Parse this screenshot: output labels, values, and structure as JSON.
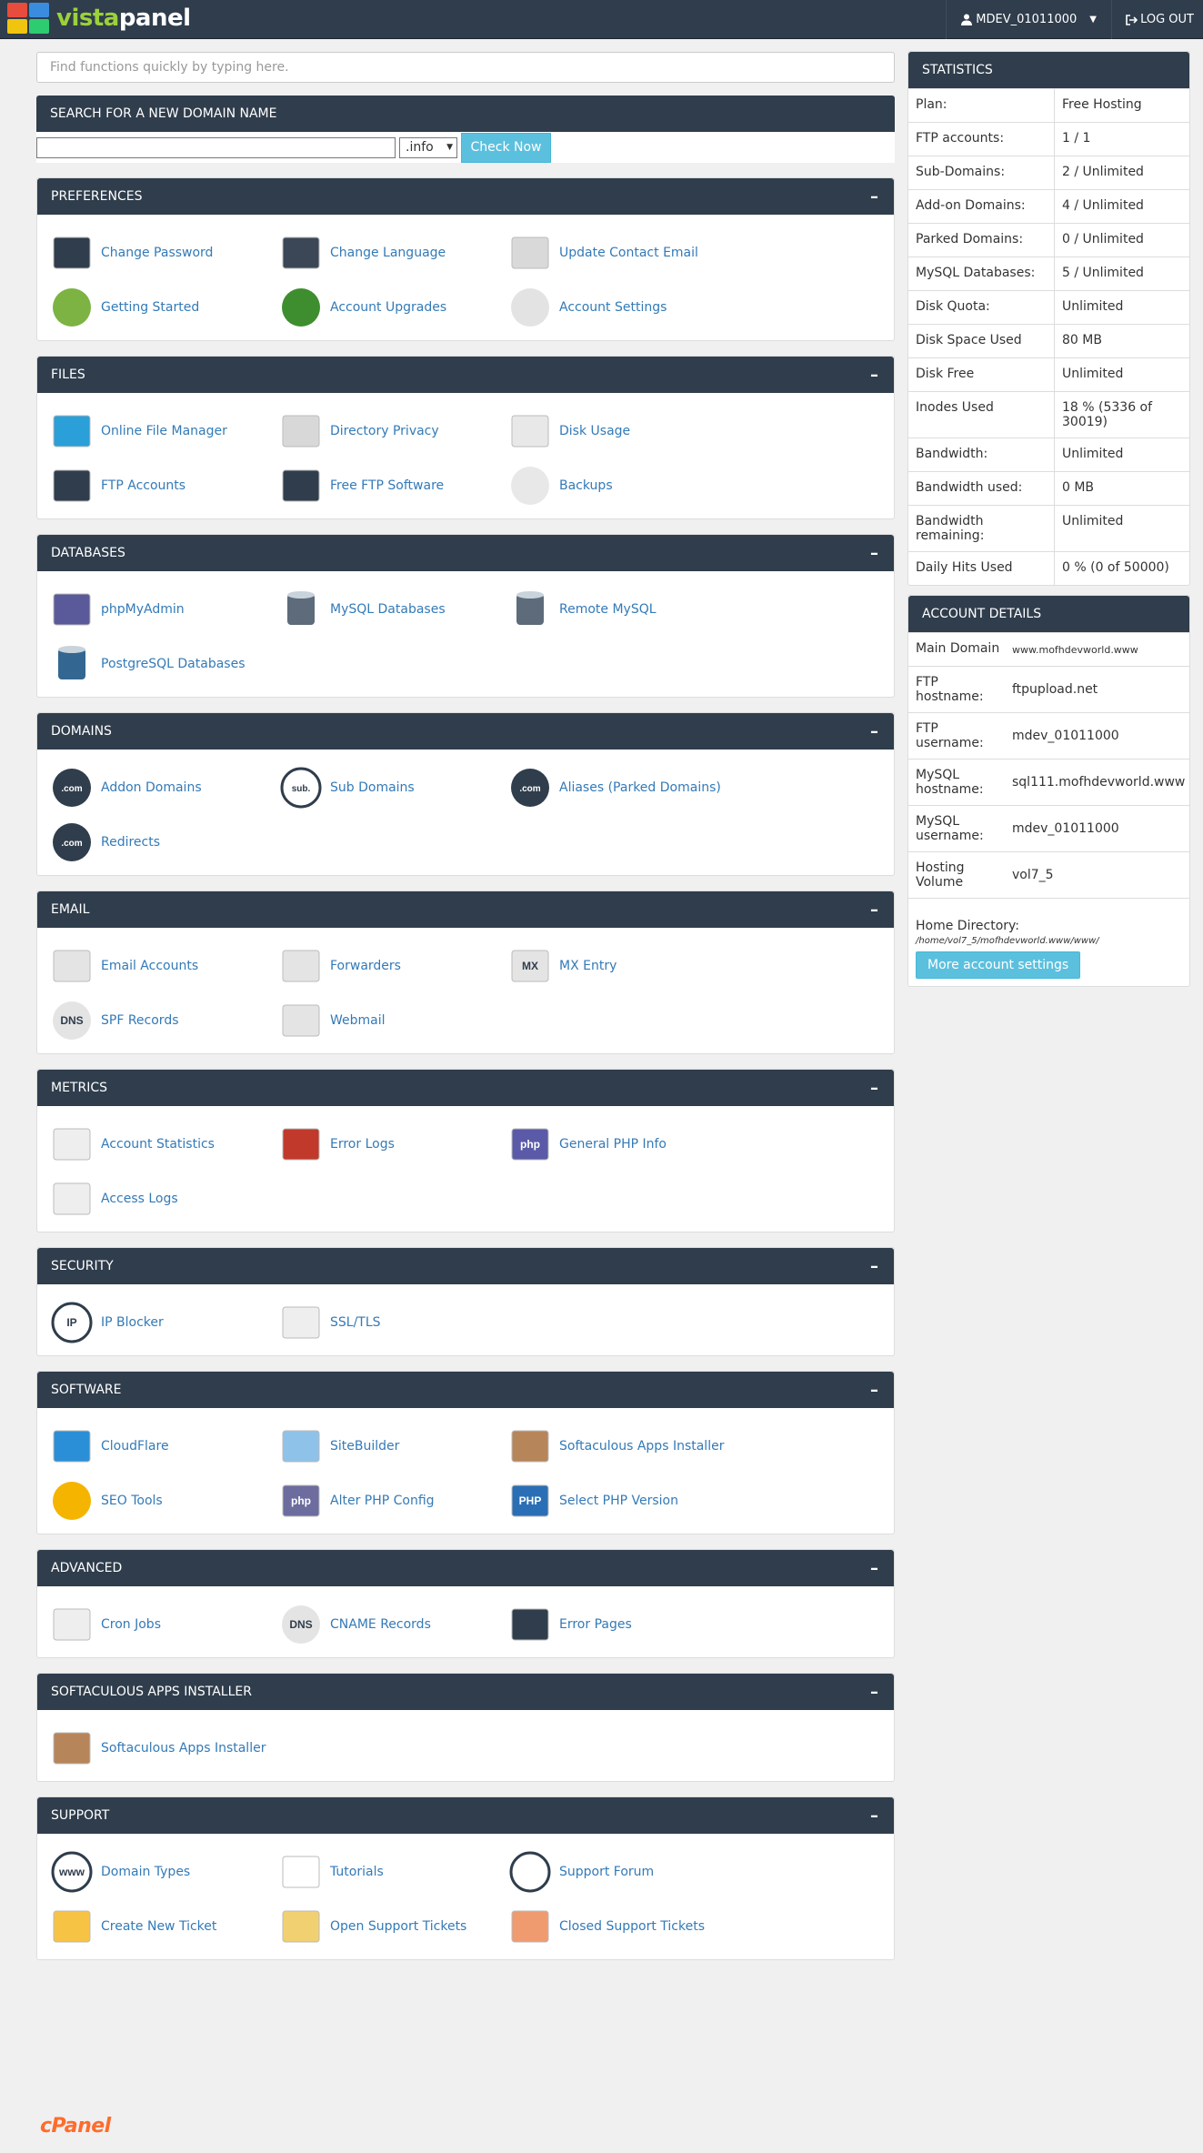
{
  "header": {
    "logo_vista": "vista",
    "logo_panel": "panel",
    "user": "MDEV_01011000",
    "logout": "LOG OUT",
    "colors": {
      "bar": "#2f3d4c",
      "logo_green": "#9bd13a"
    }
  },
  "quick_search": {
    "placeholder": "Find functions quickly by typing here."
  },
  "domain_search": {
    "title": "SEARCH FOR A NEW DOMAIN NAME",
    "tld": ".info",
    "button": "Check Now"
  },
  "sections": [
    {
      "title": "PREFERENCES",
      "items": [
        {
          "label": "Change Password",
          "icon": "password-icon"
        },
        {
          "label": "Change Language",
          "icon": "language-icon"
        },
        {
          "label": "Update Contact Email",
          "icon": "contact-card-icon"
        },
        {
          "label": "Getting Started",
          "icon": "getting-started-icon"
        },
        {
          "label": "Account Upgrades",
          "icon": "dragon-icon"
        },
        {
          "label": "Account Settings",
          "icon": "account-settings-icon"
        }
      ]
    },
    {
      "title": "FILES",
      "items": [
        {
          "label": "Online File Manager",
          "icon": "file-manager-icon"
        },
        {
          "label": "Directory Privacy",
          "icon": "folder-icon"
        },
        {
          "label": "Disk Usage",
          "icon": "disk-usage-icon"
        },
        {
          "label": "FTP Accounts",
          "icon": "ftp-truck-icon"
        },
        {
          "label": "Free FTP Software",
          "icon": "ftp-software-icon"
        },
        {
          "label": "Backups",
          "icon": "backup-icon"
        }
      ]
    },
    {
      "title": "DATABASES",
      "items": [
        {
          "label": "phpMyAdmin",
          "icon": "phpmyadmin-icon"
        },
        {
          "label": "MySQL Databases",
          "icon": "mysql-icon"
        },
        {
          "label": "Remote MySQL",
          "icon": "remote-mysql-icon"
        },
        {
          "label": "PostgreSQL Databases",
          "icon": "postgresql-icon"
        }
      ]
    },
    {
      "title": "DOMAINS",
      "items": [
        {
          "label": "Addon Domains",
          "icon": "addon-domain-icon",
          "glyph": ".com"
        },
        {
          "label": "Sub Domains",
          "icon": "subdomain-icon",
          "glyph": "sub."
        },
        {
          "label": "Aliases (Parked Domains)",
          "icon": "alias-domain-icon",
          "glyph": ".com"
        },
        {
          "label": "Redirects",
          "icon": "redirect-icon",
          "glyph": ".com"
        }
      ]
    },
    {
      "title": "EMAIL",
      "items": [
        {
          "label": "Email Accounts",
          "icon": "email-accounts-icon"
        },
        {
          "label": "Forwarders",
          "icon": "forwarder-icon"
        },
        {
          "label": "MX Entry",
          "icon": "mx-entry-icon",
          "glyph": "MX"
        },
        {
          "label": "SPF Records",
          "icon": "spf-icon",
          "glyph": "DNS"
        },
        {
          "label": "Webmail",
          "icon": "webmail-icon"
        }
      ]
    },
    {
      "title": "METRICS",
      "items": [
        {
          "label": "Account Statistics",
          "icon": "statistics-icon"
        },
        {
          "label": "Error Logs",
          "icon": "error-log-icon"
        },
        {
          "label": "General PHP Info",
          "icon": "php-info-icon",
          "glyph": "php"
        },
        {
          "label": "Access Logs",
          "icon": "access-log-icon"
        }
      ]
    },
    {
      "title": "SECURITY",
      "items": [
        {
          "label": "IP Blocker",
          "icon": "ip-blocker-icon",
          "glyph": "IP"
        },
        {
          "label": "SSL/TLS",
          "icon": "ssl-icon"
        }
      ]
    },
    {
      "title": "SOFTWARE",
      "items": [
        {
          "label": "CloudFlare",
          "icon": "cloudflare-icon"
        },
        {
          "label": "SiteBuilder",
          "icon": "sitebuilder-icon"
        },
        {
          "label": "Softaculous Apps Installer",
          "icon": "softaculous-icon"
        },
        {
          "label": "SEO Tools",
          "icon": "lightbulb-icon"
        },
        {
          "label": "Alter PHP Config",
          "icon": "php-config-icon",
          "glyph": "php"
        },
        {
          "label": "Select PHP Version",
          "icon": "php-version-icon",
          "glyph": "PHP"
        }
      ]
    },
    {
      "title": "ADVANCED",
      "items": [
        {
          "label": "Cron Jobs",
          "icon": "calendar-icon"
        },
        {
          "label": "CNAME Records",
          "icon": "cname-icon",
          "glyph": "DNS"
        },
        {
          "label": "Error Pages",
          "icon": "error-page-icon"
        }
      ]
    },
    {
      "title": "SOFTACULOUS APPS INSTALLER",
      "items": [
        {
          "label": "Softaculous Apps Installer",
          "icon": "softaculous-icon"
        }
      ]
    },
    {
      "title": "SUPPORT",
      "items": [
        {
          "label": "Domain Types",
          "icon": "www-globe-icon",
          "glyph": "www"
        },
        {
          "label": "Tutorials",
          "icon": "tutorials-icon"
        },
        {
          "label": "Support Forum",
          "icon": "forum-icon"
        },
        {
          "label": "Create New Ticket",
          "icon": "pencil-icon"
        },
        {
          "label": "Open Support Tickets",
          "icon": "open-ticket-icon"
        },
        {
          "label": "Closed Support Tickets",
          "icon": "closed-ticket-icon"
        }
      ]
    }
  ],
  "statistics": {
    "title": "STATISTICS",
    "rows": [
      {
        "k": "Plan:",
        "v": "Free Hosting"
      },
      {
        "k": "FTP accounts:",
        "v": "1 / 1"
      },
      {
        "k": "Sub-Domains:",
        "v": "2 / Unlimited"
      },
      {
        "k": "Add-on Domains:",
        "v": "4 / Unlimited"
      },
      {
        "k": "Parked Domains:",
        "v": "0 / Unlimited"
      },
      {
        "k": "MySQL Databases:",
        "v": "5 / Unlimited"
      },
      {
        "k": "Disk Quota:",
        "v": "Unlimited"
      },
      {
        "k": "Disk Space Used",
        "v": "80 MB"
      },
      {
        "k": "Disk Free",
        "v": "Unlimited"
      },
      {
        "k": "Inodes Used",
        "v": "18 % (5336 of 30019)"
      },
      {
        "k": "Bandwidth:",
        "v": "Unlimited"
      },
      {
        "k": "Bandwidth used:",
        "v": "0 MB"
      },
      {
        "k": "Bandwidth remaining:",
        "v": "Unlimited"
      },
      {
        "k": "Daily Hits Used",
        "v": "0 % (0 of 50000)"
      }
    ]
  },
  "account": {
    "title": "ACCOUNT DETAILS",
    "rows": [
      {
        "k": "Main Domain",
        "v": "www.mofhdevworld.www"
      },
      {
        "k": "FTP hostname:",
        "v": "ftpupload.net"
      },
      {
        "k": "FTP username:",
        "v": "mdev_01011000"
      },
      {
        "k": "MySQL hostname:",
        "v": "sql111.mofhdevworld.www"
      },
      {
        "k": "MySQL username:",
        "v": "mdev_01011000"
      },
      {
        "k": "Hosting Volume",
        "v": "vol7_5"
      }
    ],
    "home_label": "Home Directory:",
    "home_path": "/home/vol7_5/mofhdevworld.www/www/",
    "more_button": "More account settings"
  },
  "footer": {
    "brand": "cPanel"
  }
}
